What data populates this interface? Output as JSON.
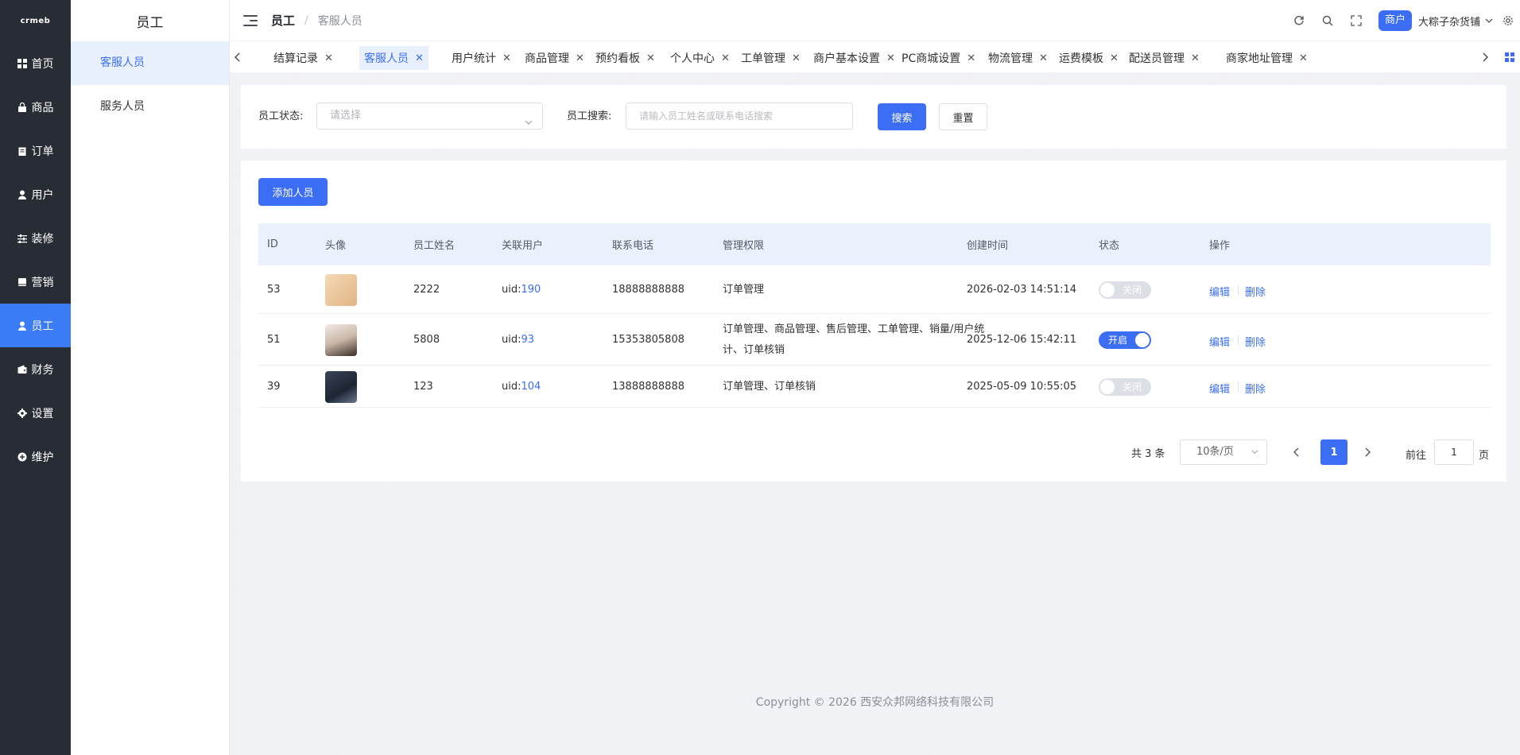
{
  "app": {
    "logo_text": "crmeb"
  },
  "sidebar": {
    "items": [
      {
        "label": "首页",
        "icon": "grid-icon"
      },
      {
        "label": "商品",
        "icon": "bag-icon"
      },
      {
        "label": "订单",
        "icon": "clipboard-icon"
      },
      {
        "label": "用户",
        "icon": "user-icon"
      },
      {
        "label": "装修",
        "icon": "sliders-icon"
      },
      {
        "label": "营销",
        "icon": "book-icon"
      },
      {
        "label": "员工",
        "icon": "person-icon"
      },
      {
        "label": "财务",
        "icon": "wallet-icon"
      },
      {
        "label": "设置",
        "icon": "gear-icon"
      },
      {
        "label": "维护",
        "icon": "plus-circle-icon"
      }
    ],
    "active_index": 6
  },
  "subsidebar": {
    "title": "员工",
    "items": [
      {
        "label": "客服人员"
      },
      {
        "label": "服务人员"
      }
    ]
  },
  "header": {
    "breadcrumb_parent": "员工",
    "breadcrumb_separator": "/",
    "breadcrumb_current": "客服人员",
    "role_badge": "商户",
    "shop_name": "大粽子杂货铺"
  },
  "tabs": [
    {
      "label": "结算记录"
    },
    {
      "label": "客服人员"
    },
    {
      "label": "用户统计"
    },
    {
      "label": "商品管理"
    },
    {
      "label": "预约看板"
    },
    {
      "label": "个人中心"
    },
    {
      "label": "工单管理"
    },
    {
      "label": "商户基本设置"
    },
    {
      "label": "PC商城设置"
    },
    {
      "label": "物流管理"
    },
    {
      "label": "运费模板"
    },
    {
      "label": "配送员管理"
    },
    {
      "label": "商家地址管理"
    }
  ],
  "filters": {
    "status_label": "员工状态:",
    "status_placeholder": "请选择",
    "search_label": "员工搜索:",
    "search_placeholder": "请输入员工姓名或联系电话搜索",
    "search_button": "搜索",
    "reset_button": "重置"
  },
  "table": {
    "add_button": "添加人员",
    "columns": [
      "ID",
      "头像",
      "员工姓名",
      "关联用户",
      "联系电话",
      "管理权限",
      "创建时间",
      "状态",
      "操作"
    ],
    "rows": [
      {
        "id": "53",
        "name": "2222",
        "uid_prefix": "uid:",
        "uid": "190",
        "phone": "18888888888",
        "permissions": "订单管理",
        "created": "2026-02-03 14:51:14",
        "status_text": "关闭",
        "status_on": false,
        "edit": "编辑",
        "delete": "删除"
      },
      {
        "id": "51",
        "name": "5808",
        "uid_prefix": "uid:",
        "uid": "93",
        "phone": "15353805808",
        "permissions": "订单管理、商品管理、售后管理、工单管理、销量/用户统计、订单核销",
        "created": "2025-12-06 15:42:11",
        "status_text": "开启",
        "status_on": true,
        "edit": "编辑",
        "delete": "删除"
      },
      {
        "id": "39",
        "name": "123",
        "uid_prefix": "uid:",
        "uid": "104",
        "phone": "13888888888",
        "permissions": "订单管理、订单核销",
        "created": "2025-05-09 10:55:05",
        "status_text": "关闭",
        "status_on": false,
        "edit": "编辑",
        "delete": "删除"
      }
    ]
  },
  "pagination": {
    "total": "共 3 条",
    "page_size": "10条/页",
    "current_page": "1",
    "goto_label": "前往",
    "goto_value": "1",
    "goto_suffix": "页"
  },
  "footer": {
    "copyright": "Copyright © 2026 西安众邦网络科技有限公司"
  },
  "colors": {
    "primary": "#3b6ef5",
    "sidebar_bg": "#282c34",
    "header_bg": "#eaf1fd"
  }
}
